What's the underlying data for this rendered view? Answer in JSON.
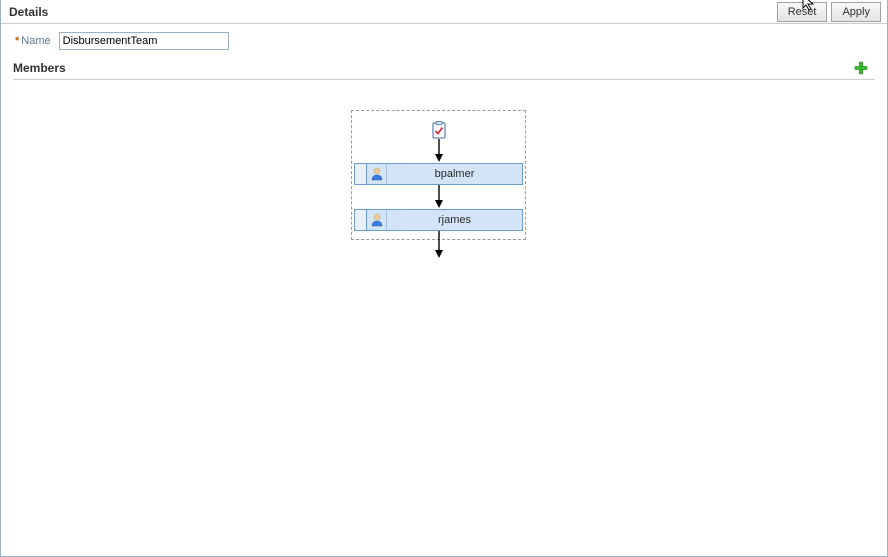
{
  "header": {
    "title": "Details",
    "reset_label": "Reset",
    "apply_label": "Apply"
  },
  "form": {
    "name_label": "Name",
    "name_value": "DisbursementTeam"
  },
  "members": {
    "section_title": "Members",
    "items": [
      {
        "label": "bpalmer"
      },
      {
        "label": "rjames"
      }
    ]
  },
  "icons": {
    "add": "add-icon",
    "clipboard": "clipboard-check-icon",
    "user": "user-icon",
    "cursor": "cursor-icon"
  }
}
